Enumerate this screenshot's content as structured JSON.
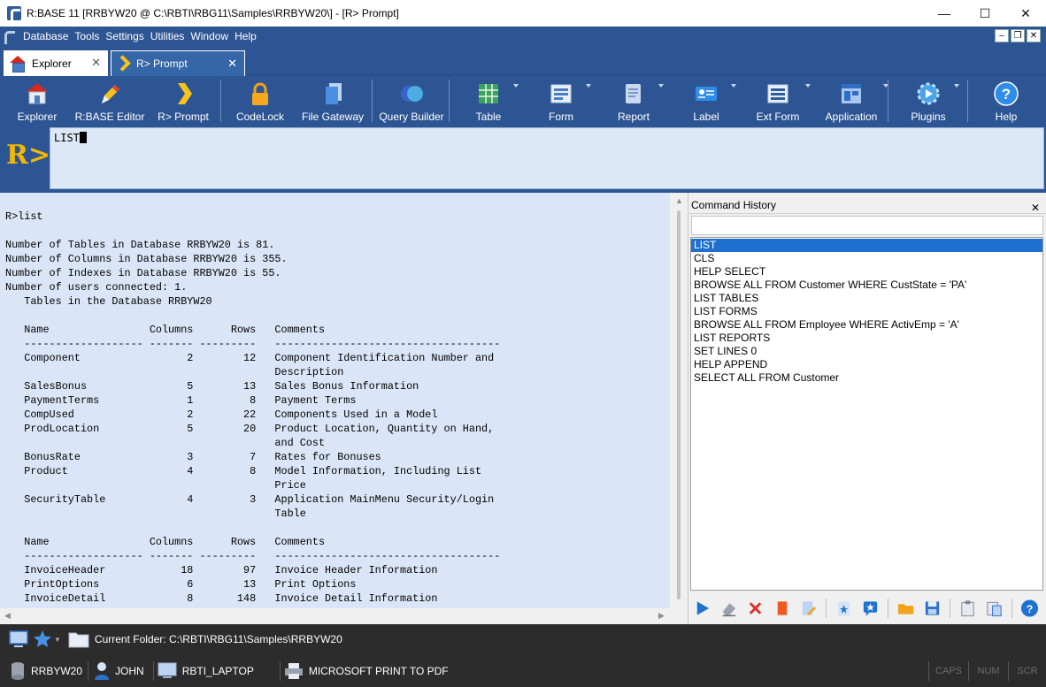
{
  "window": {
    "title": "R:BASE 11 [RRBYW20 @ C:\\RBTI\\RBG11\\Samples\\RRBYW20\\] - [R> Prompt]",
    "minimize": "—",
    "maximize": "☐",
    "close": "✕"
  },
  "menu": {
    "items": [
      "Database",
      "Tools",
      "Settings",
      "Utilities",
      "Window",
      "Help"
    ],
    "mdi_min": "–",
    "mdi_restore": "❐",
    "mdi_close": "✕"
  },
  "tabs": [
    {
      "label": "Explorer",
      "close": "✕"
    },
    {
      "label": "R> Prompt",
      "close": "✕"
    }
  ],
  "toolbar": {
    "buttons": [
      "Explorer",
      "R:BASE Editor",
      "R> Prompt",
      "CodeLock",
      "File Gateway",
      "Query Builder",
      "Table",
      "Form",
      "Report",
      "Label",
      "Ext Form",
      "Application",
      "Plugins",
      "Help"
    ]
  },
  "prompt": {
    "label": "R>",
    "command": "LIST"
  },
  "output": {
    "text": "R>list\n\nNumber of Tables in Database RRBYW20 is 81.\nNumber of Columns in Database RRBYW20 is 355.\nNumber of Indexes in Database RRBYW20 is 55.\nNumber of users connected: 1.\n   Tables in the Database RRBYW20\n\n   Name                Columns      Rows   Comments\n   ------------------- ------- ---------   ------------------------------------\n   Component                 2        12   Component Identification Number and\n                                           Description\n   SalesBonus                5        13   Sales Bonus Information\n   PaymentTerms              1         8   Payment Terms\n   CompUsed                  2        22   Components Used in a Model\n   ProdLocation              5        20   Product Location, Quantity on Hand,\n                                           and Cost\n   BonusRate                 3         7   Rates for Bonuses\n   Product                   4         8   Model Information, Including List\n                                           Price\n   SecurityTable             4         3   Application MainMenu Security/Login\n                                           Table\n\n   Name                Columns      Rows   Comments\n   ------------------- ------- ---------   ------------------------------------\n   InvoiceHeader            18        97   Invoice Header Information\n   PrintOptions              6        13   Print Options\n   InvoiceDetail             8       148   Invoice Detail Information"
  },
  "history": {
    "title": "Command History",
    "close": "✕",
    "items": [
      "LIST",
      "CLS",
      "HELP SELECT",
      "BROWSE ALL FROM Customer WHERE CustState = 'PA'",
      "LIST TABLES",
      "LIST FORMS",
      "BROWSE ALL FROM Employee WHERE ActivEmp = 'A'",
      "LIST REPORTS",
      "SET LINES 0",
      "HELP APPEND",
      "SELECT ALL FROM Customer"
    ],
    "selected_index": 0
  },
  "status": {
    "folder_label": "Current Folder: C:\\RBTI\\RBG11\\Samples\\RRBYW20",
    "database": "RRBYW20",
    "user": "JOHN",
    "computer": "RBTI_LAPTOP",
    "printer": "MICROSOFT PRINT TO PDF",
    "caps": "CAPS",
    "num": "NUM",
    "scr": "SCR"
  },
  "colors": {
    "menu_bg": "#2e5593",
    "output_bg": "#dae6f7",
    "history_selected": "#1e6fd0",
    "prompt_label": "#f2b800"
  }
}
